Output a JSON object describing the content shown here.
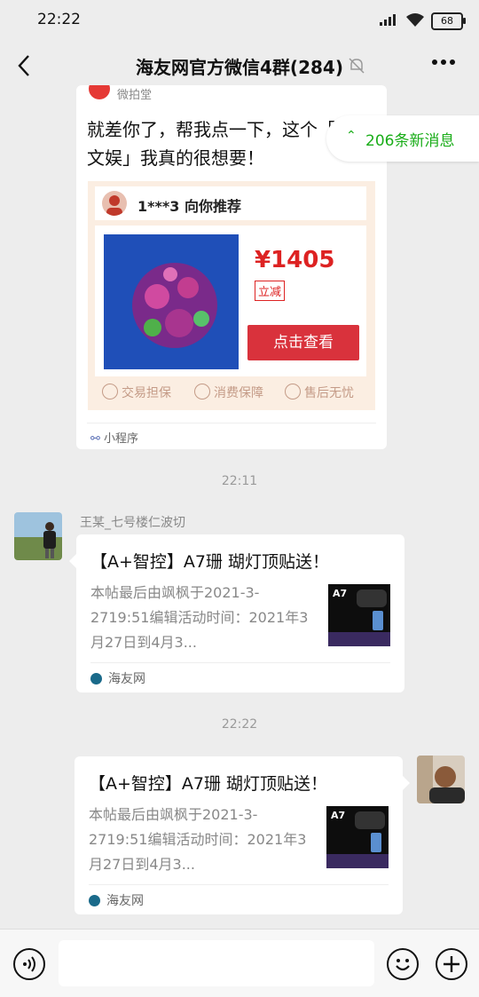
{
  "status_bar": {
    "time": "22:22",
    "battery": "68"
  },
  "nav": {
    "title": "海友网官方微信4群(284)"
  },
  "new_messages": {
    "label": "206条新消息"
  },
  "mini_program_card": {
    "source": "微拍堂",
    "message": "就差你了，帮我点一下，这个「花鸟文娱」我真的很想要！",
    "recommender": "1***3 向你推荐",
    "price": "¥1405",
    "discount_tag": "立减",
    "view_button": "点击查看",
    "guarantees": [
      "交易担保",
      "消费保障",
      "售后无忧"
    ],
    "footer_label": "小程序"
  },
  "timestamps": [
    "22:11",
    "22:22"
  ],
  "messages": [
    {
      "sender": "王某_七号楼仁波切",
      "title": "【A+智控】A7珊 瑚灯顶贴送！",
      "desc": "本帖最后由飒枫于2021-3-2719:51编辑活动时间：2021年3月27日到4月3...",
      "source": "海友网"
    },
    {
      "title": "【A+智控】A7珊 瑚灯顶贴送！",
      "desc": "本帖最后由飒枫于2021-3-2719:51编辑活动时间：2021年3月27日到4月3...",
      "source": "海友网"
    }
  ],
  "colors": {
    "accent_green": "#1aad19",
    "price_red": "#d22",
    "button_red": "#d9323c"
  }
}
